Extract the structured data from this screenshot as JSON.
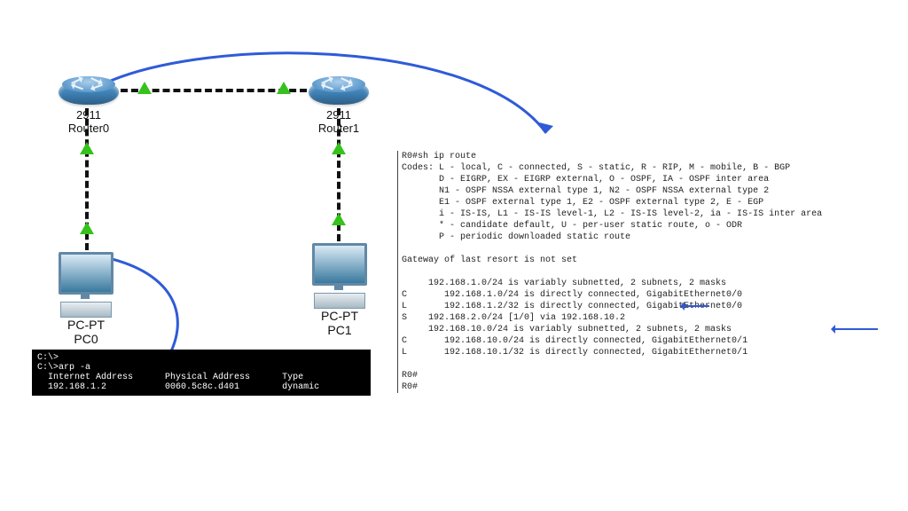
{
  "devices": {
    "router0": {
      "model": "2911",
      "name": "Router0"
    },
    "router1": {
      "model": "2911",
      "name": "Router1"
    },
    "pc0": {
      "type": "PC-PT",
      "name": "PC0"
    },
    "pc1": {
      "type": "PC-PT",
      "name": "PC1"
    }
  },
  "terminal_pc0": {
    "prompt1": "C:\\>",
    "cmd": "C:\\>arp -a",
    "hdr_ip": "  Internet Address",
    "hdr_mac": "Physical Address",
    "hdr_type": "Type",
    "row_ip": "  192.168.1.2",
    "row_mac": "0060.5c8c.d401",
    "row_type": "dynamic"
  },
  "cli_router0": {
    "cmd": "R0#sh ip route",
    "codes_hdr": "Codes: L - local, C - connected, S - static, R - RIP, M - mobile, B - BGP",
    "codes_l2": "       D - EIGRP, EX - EIGRP external, O - OSPF, IA - OSPF inter area",
    "codes_l3": "       N1 - OSPF NSSA external type 1, N2 - OSPF NSSA external type 2",
    "codes_l4": "       E1 - OSPF external type 1, E2 - OSPF external type 2, E - EGP",
    "codes_l5": "       i - IS-IS, L1 - IS-IS level-1, L2 - IS-IS level-2, ia - IS-IS inter area",
    "codes_l6": "       * - candidate default, U - per-user static route, o - ODR",
    "codes_l7": "       P - periodic downloaded static route",
    "gw": "Gateway of last resort is not set",
    "r1": "     192.168.1.0/24 is variably subnetted, 2 subnets, 2 masks",
    "r2": "C       192.168.1.0/24 is directly connected, GigabitEthernet0/0",
    "r3": "L       192.168.1.2/32 is directly connected, GigabitEthernet0/0",
    "r4": "S    192.168.2.0/24 [1/0] via 192.168.10.2",
    "r5": "     192.168.10.0/24 is variably subnetted, 2 subnets, 2 masks",
    "r6": "C       192.168.10.0/24 is directly connected, GigabitEthernet0/1",
    "r7": "L       192.168.10.1/32 is directly connected, GigabitEthernet0/1",
    "end1": "R0#",
    "end2": "R0#"
  }
}
